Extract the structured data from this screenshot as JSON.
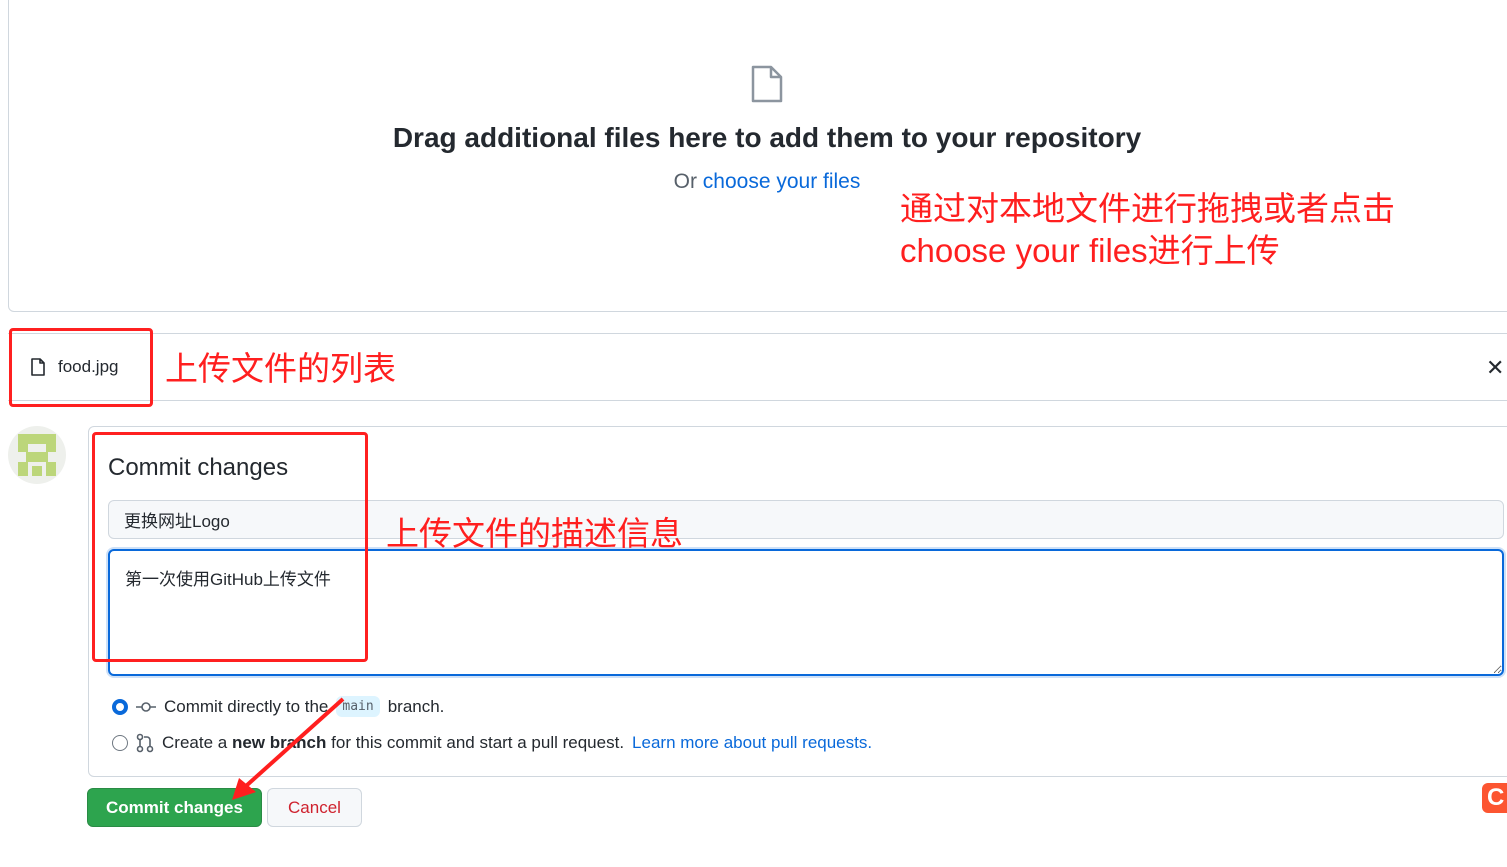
{
  "dropzone": {
    "title": "Drag additional files here to add them to your repository",
    "or_text": "Or",
    "choose_link": "choose your files"
  },
  "files": [
    {
      "name": "food.jpg",
      "icon": "file-icon"
    }
  ],
  "commit": {
    "title": "Commit changes",
    "summary_value": "更换网址Logo",
    "description_value": "第一次使用GitHub上传文件",
    "option_direct": {
      "pre": "Commit directly to the",
      "branch": "main",
      "post": "branch.",
      "selected": true
    },
    "option_new": {
      "pre": "Create a",
      "bold": "new branch",
      "post": "for this commit and start a pull request.",
      "link": "Learn more about pull requests.",
      "selected": false
    },
    "commit_button": "Commit changes",
    "cancel_button": "Cancel"
  },
  "annotations": {
    "upload_hint_line1": "通过对本地文件进行拖拽或者点击",
    "upload_hint_line2": "choose your files进行上传",
    "file_list": "上传文件的列表",
    "description": "上传文件的描述信息",
    "color": "#ff1f1f"
  },
  "watermark": "CSDN",
  "colors": {
    "primary": "#2da44e",
    "link": "#0969da",
    "danger": "#cf222e"
  }
}
